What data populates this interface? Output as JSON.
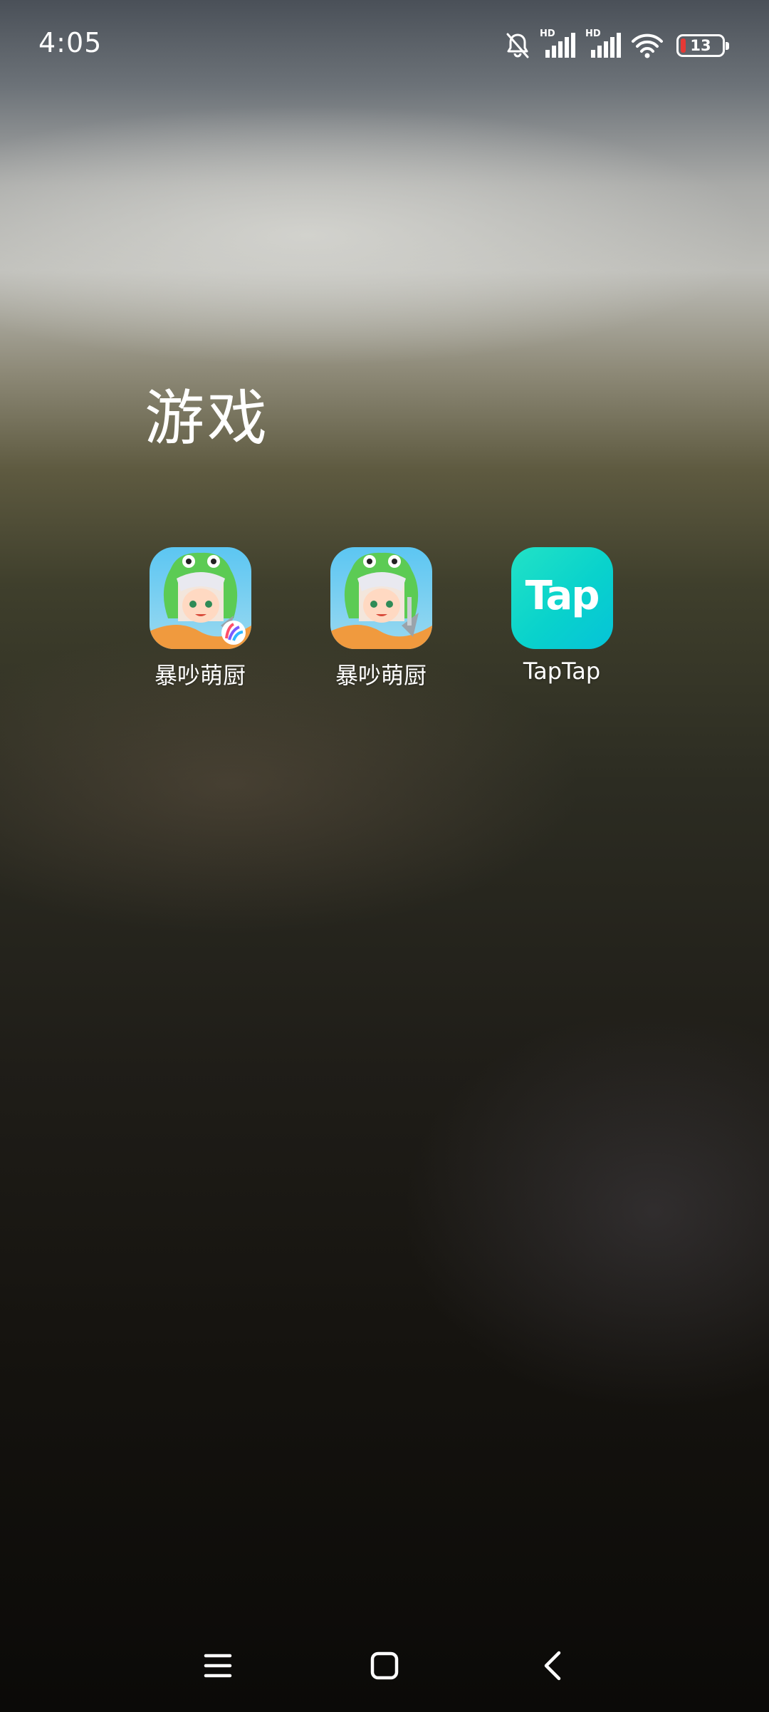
{
  "status_bar": {
    "time": "4:05",
    "icons": [
      "bell-off-icon",
      "signal-hd-icon",
      "signal-hd-icon",
      "wifi-icon",
      "battery-icon"
    ],
    "signal_badge_1": "HD",
    "signal_badge_2": "HD",
    "battery_level": "13",
    "battery_low_color": "#e53935"
  },
  "folder": {
    "title": "游戏",
    "apps": [
      {
        "label": "暴吵萌厨",
        "icon": "game-character-icon"
      },
      {
        "label": "暴吵萌厨",
        "icon": "game-character-icon"
      },
      {
        "label": "TapTap",
        "icon": "taptap-icon",
        "icon_text": "Tap",
        "accent": "#0ad4cb"
      }
    ]
  },
  "nav_bar": {
    "icons": [
      "menu-icon",
      "home-icon",
      "back-icon"
    ]
  }
}
